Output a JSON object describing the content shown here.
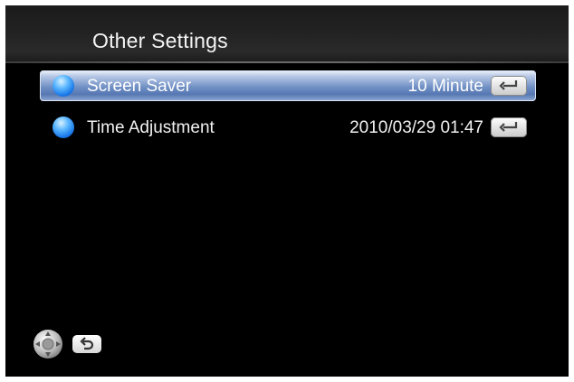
{
  "header": {
    "title": "Other Settings"
  },
  "menu": {
    "items": [
      {
        "label": "Screen Saver",
        "value": "10 Minute",
        "selected": true,
        "icon": "blue-orb-icon",
        "action_icon": "enter-key-icon"
      },
      {
        "label": "Time Adjustment",
        "value": "2010/03/29 01:47",
        "selected": false,
        "icon": "blue-orb-icon",
        "action_icon": "enter-key-icon"
      }
    ]
  },
  "footer": {
    "icons": [
      "dpad-icon",
      "back-arrow-icon"
    ]
  },
  "colors": {
    "background": "#000000",
    "selection": "#6f8fc4",
    "orb": "#1a78e8",
    "text": "#f2f2f2"
  }
}
